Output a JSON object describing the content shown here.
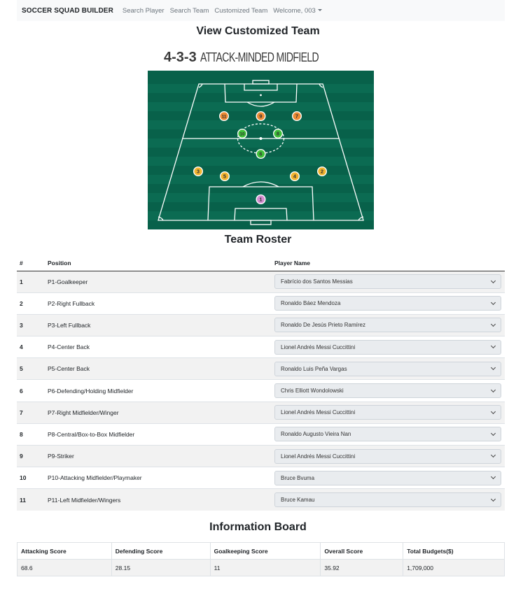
{
  "navbar": {
    "brand": "SOCCER SQUAD BUILDER",
    "links": [
      "Search Player",
      "Search Team",
      "Customized Team"
    ],
    "user_menu": "Welcome, 003"
  },
  "page_title": "View Customized Team",
  "formation": {
    "number": "4-3-3",
    "name": "ATTACK-MINDED MIDFIELD",
    "markers": [
      {
        "num": "1",
        "color": "#d48ed1"
      },
      {
        "num": "2",
        "color": "#f2b42f"
      },
      {
        "num": "3",
        "color": "#f2b42f"
      },
      {
        "num": "4",
        "color": "#f2b42f"
      },
      {
        "num": "5",
        "color": "#f2b42f"
      },
      {
        "num": "6",
        "color": "#3fbf3a"
      },
      {
        "num": "7",
        "color": "#ec8a33"
      },
      {
        "num": "8",
        "color": "#3fbf3a"
      },
      {
        "num": "9",
        "color": "#ec8a33"
      },
      {
        "num": "10",
        "color": "#3fbf3a"
      },
      {
        "num": "11",
        "color": "#ec8a33"
      }
    ]
  },
  "roster": {
    "title": "Team Roster",
    "headers": [
      "#",
      "Position",
      "Player Name"
    ],
    "rows": [
      {
        "num": "1",
        "position": "P1-Goalkeeper",
        "player": "Fabrício dos Santos Messias"
      },
      {
        "num": "2",
        "position": "P2-Right Fullback",
        "player": "Ronaldo Báez Mendoza"
      },
      {
        "num": "3",
        "position": "P3-Left Fullback",
        "player": "Ronaldo De Jesús Prieto Ramírez"
      },
      {
        "num": "4",
        "position": "P4-Center Back",
        "player": "Lionel Andrés Messi Cuccittini"
      },
      {
        "num": "5",
        "position": "P5-Center Back",
        "player": "Ronaldo Luis Peña Vargas"
      },
      {
        "num": "6",
        "position": "P6-Defending/Holding Midfielder",
        "player": "Chris Elliott Wondolowski"
      },
      {
        "num": "7",
        "position": "P7-Right Midfielder/Winger",
        "player": "Lionel Andrés Messi Cuccittini"
      },
      {
        "num": "8",
        "position": "P8-Central/Box-to-Box Midfielder",
        "player": "Ronaldo Augusto Vieira Nan"
      },
      {
        "num": "9",
        "position": "P9-Striker",
        "player": "Lionel Andrés Messi Cuccittini"
      },
      {
        "num": "10",
        "position": "P10-Attacking Midfielder/Playmaker",
        "player": "Bruce Bvuma"
      },
      {
        "num": "11",
        "position": "P11-Left Midfielder/Wingers",
        "player": "Bruce Kamau"
      }
    ]
  },
  "info_board": {
    "title": "Information Board",
    "headers": [
      "Attacking Score",
      "Defending Score",
      "Goalkeeping Score",
      "Overall Score",
      "Total Budgets($)"
    ],
    "values": [
      "68.6",
      "28.15",
      "11",
      "35.92",
      "1,709,000"
    ]
  },
  "colors": {
    "pitch": "#08614a",
    "pitch_stripe": "#0b6b52",
    "navbar_bg": "#f8f9fa"
  }
}
